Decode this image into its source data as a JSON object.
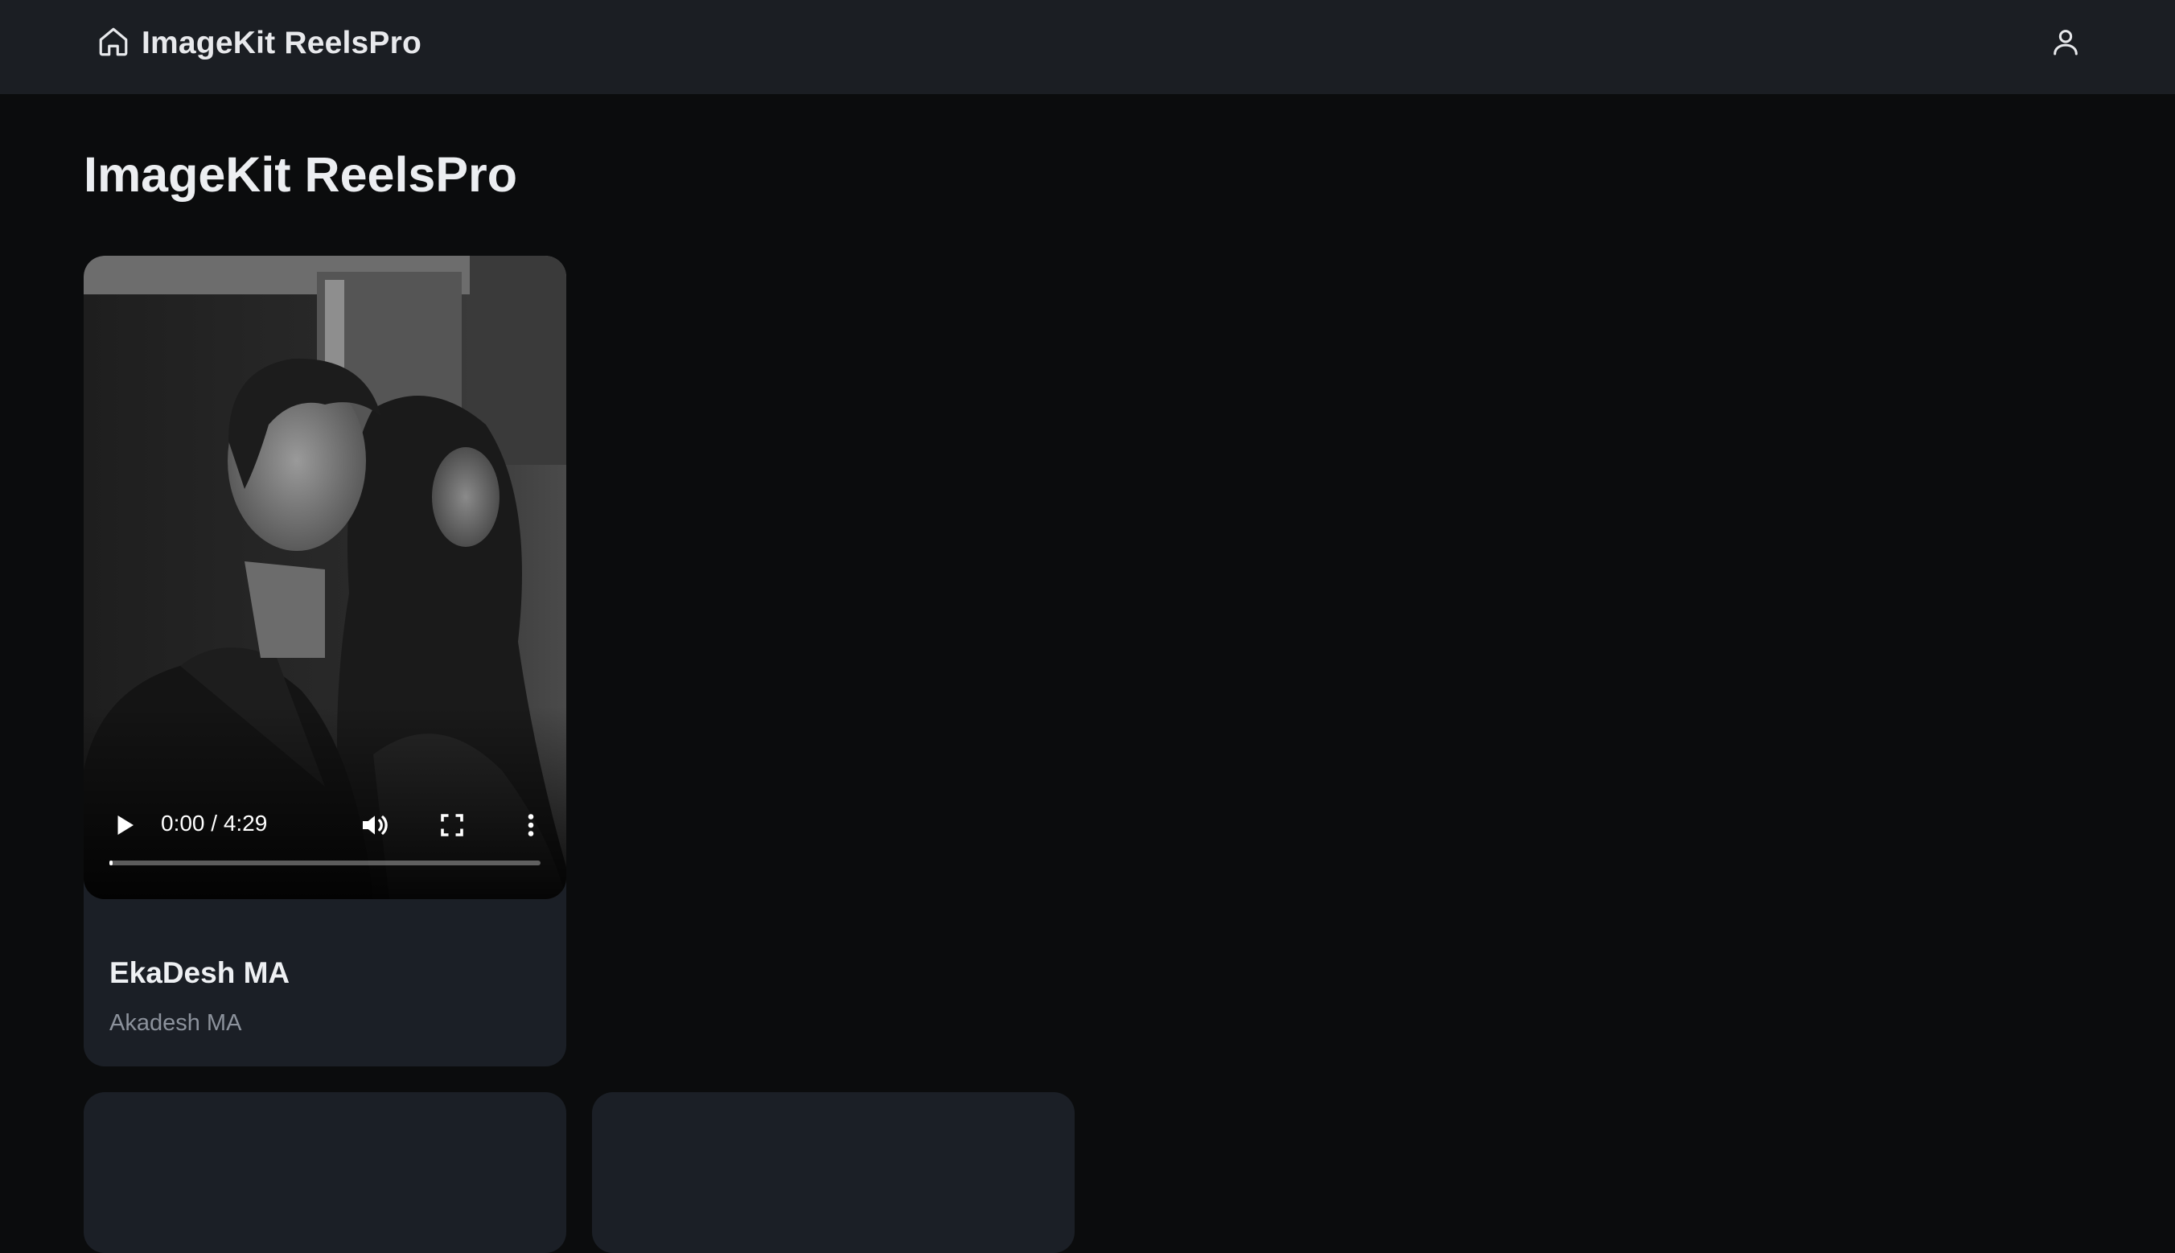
{
  "navbar": {
    "brand_label": "ImageKit ReelsPro",
    "home_icon": "home-icon",
    "user_icon": "user-icon"
  },
  "page": {
    "title": "ImageKit ReelsPro"
  },
  "videos": [
    {
      "title": "EkaDesh MA",
      "description": "Akadesh MA",
      "player": {
        "time_display": "0:00 / 4:29",
        "progress": 0.0,
        "icons": [
          "play-icon",
          "volume-icon",
          "fullscreen-icon",
          "more-options-icon"
        ]
      }
    }
  ],
  "colors": {
    "navbar_bg": "#1b1e23",
    "page_bg": "#0b0c0d",
    "card_bg": "#1b1f26",
    "title_text": "#eceef1",
    "muted_text": "#8c929c"
  }
}
